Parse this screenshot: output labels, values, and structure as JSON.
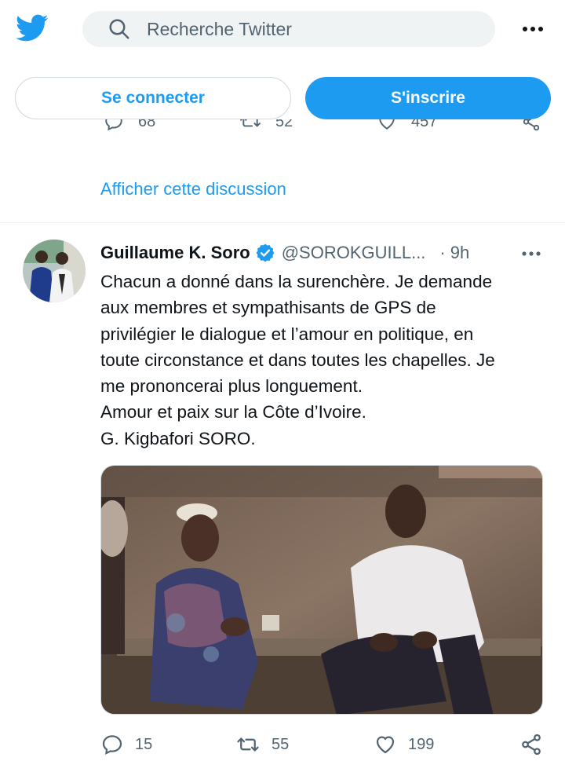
{
  "header": {
    "search_placeholder": "Recherche Twitter"
  },
  "auth": {
    "login_label": "Se connecter",
    "signup_label": "S'inscrire"
  },
  "previous_tweet": {
    "replies": "68",
    "retweets": "52",
    "likes": "457"
  },
  "thread": {
    "show_label": "Afficher cette discussion"
  },
  "tweet": {
    "author_name": "Guillaume K. Soro",
    "handle": "@SOROKGUILL...",
    "separator": "·",
    "time": "9h",
    "text_lines": [
      "Chacun a donné dans la surenchère. Je demande",
      "aux membres et sympathisants de GPS de",
      "privilégier le dialogue et l’amour en politique, en",
      "toute circonstance et dans toutes les chapelles. Je",
      "me prononcerai plus longuement.",
      "Amour et paix sur la Côte d’Ivoire.",
      "G. Kigbafori SORO."
    ],
    "replies": "15",
    "retweets": "55",
    "likes": "199"
  },
  "colors": {
    "accent": "#1d9bf0",
    "text": "#0f1419",
    "muted": "#536471",
    "search_bg": "#eff3f4",
    "border": "#cfd9de"
  },
  "icons": [
    "twitter-bird-icon",
    "search-icon",
    "more-icon",
    "verified-badge-icon",
    "reply-icon",
    "retweet-icon",
    "like-icon",
    "share-icon"
  ]
}
